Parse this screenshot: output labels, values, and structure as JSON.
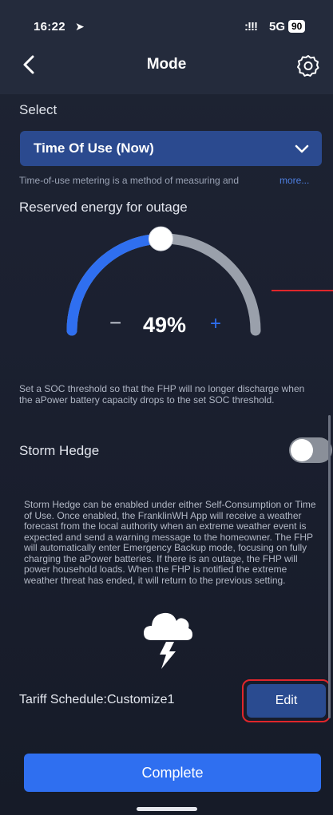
{
  "status_bar": {
    "time": "16:22",
    "signal": ":!!!",
    "network": "5G",
    "battery": "90"
  },
  "nav": {
    "title": "Mode"
  },
  "select": {
    "label": "Select",
    "value": "Time Of Use (Now)"
  },
  "tou": {
    "description": "Time-of-use metering is a method of measuring and",
    "more": "more..."
  },
  "reserve": {
    "label": "Reserved energy for outage",
    "minus": "−",
    "value": "49%",
    "plus": "+",
    "level": 0.49,
    "note": "Set a SOC threshold so that the FHP will no longer discharge when the aPower battery capacity drops to the set SOC threshold."
  },
  "storm": {
    "label": "Storm Hedge",
    "enabled": false,
    "description": "Storm Hedge can be enabled under either Self-Consumption or Time of Use. Once enabled, the FranklinWH App will receive a weather forecast from the local authority when an extreme weather event is expected and send a warning message to the homeowner. The FHP will automatically enter Emergency Backup mode, focusing on fully charging the aPower batteries. If there is an outage, the FHP will power household loads. When the FHP is notified the extreme weather threat has ended, it will return to the previous setting."
  },
  "tariff": {
    "label": "Tariff Schedule:Customize1",
    "edit": "Edit"
  },
  "footer": {
    "complete": "Complete"
  },
  "colors": {
    "accent": "#2f6ff0",
    "select_bg": "#2b4a8f",
    "highlight": "#e0262b"
  }
}
